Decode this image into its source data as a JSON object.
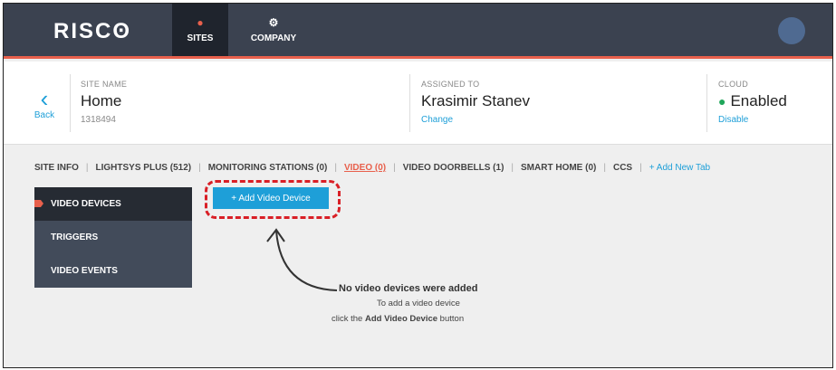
{
  "brand": {
    "logo": "RISCʘ"
  },
  "nav": {
    "sites": {
      "label": "SITES",
      "icon": "map-pin-icon"
    },
    "company": {
      "label": "COMPANY",
      "icon": "gear-icon"
    }
  },
  "site": {
    "back_label": "Back",
    "name_label": "SITE NAME",
    "name": "Home",
    "site_id": "1318494",
    "assigned_label": "ASSIGNED TO",
    "assigned_to": "Krasimir Stanev",
    "change_link": "Change",
    "cloud_label": "CLOUD",
    "cloud_status": "Enabled",
    "cloud_action": "Disable"
  },
  "tabs": [
    {
      "label": "SITE INFO"
    },
    {
      "label": "LIGHTSYS PLUS (512)"
    },
    {
      "label": "MONITORING STATIONS (0)"
    },
    {
      "label": "VIDEO (0)"
    },
    {
      "label": "VIDEO DOORBELLS (1)"
    },
    {
      "label": "SMART HOME (0)"
    },
    {
      "label": "CCS"
    },
    {
      "label": "+ Add New Tab"
    }
  ],
  "side_menu": [
    {
      "label": "VIDEO DEVICES"
    },
    {
      "label": "TRIGGERS"
    },
    {
      "label": "VIDEO EVENTS"
    }
  ],
  "add_button": {
    "label": "+ Add Video Device"
  },
  "empty_state": {
    "title": "No video devices were added",
    "line1": "To add a video device",
    "line2_prefix": "click the ",
    "line2_bold": "Add Video Device",
    "line2_suffix": " button"
  },
  "colors": {
    "topbar": "#3b4250",
    "accent": "#e8604c",
    "link": "#1e9fd8",
    "enabled": "#1fa65a",
    "callout": "#d91f26"
  }
}
